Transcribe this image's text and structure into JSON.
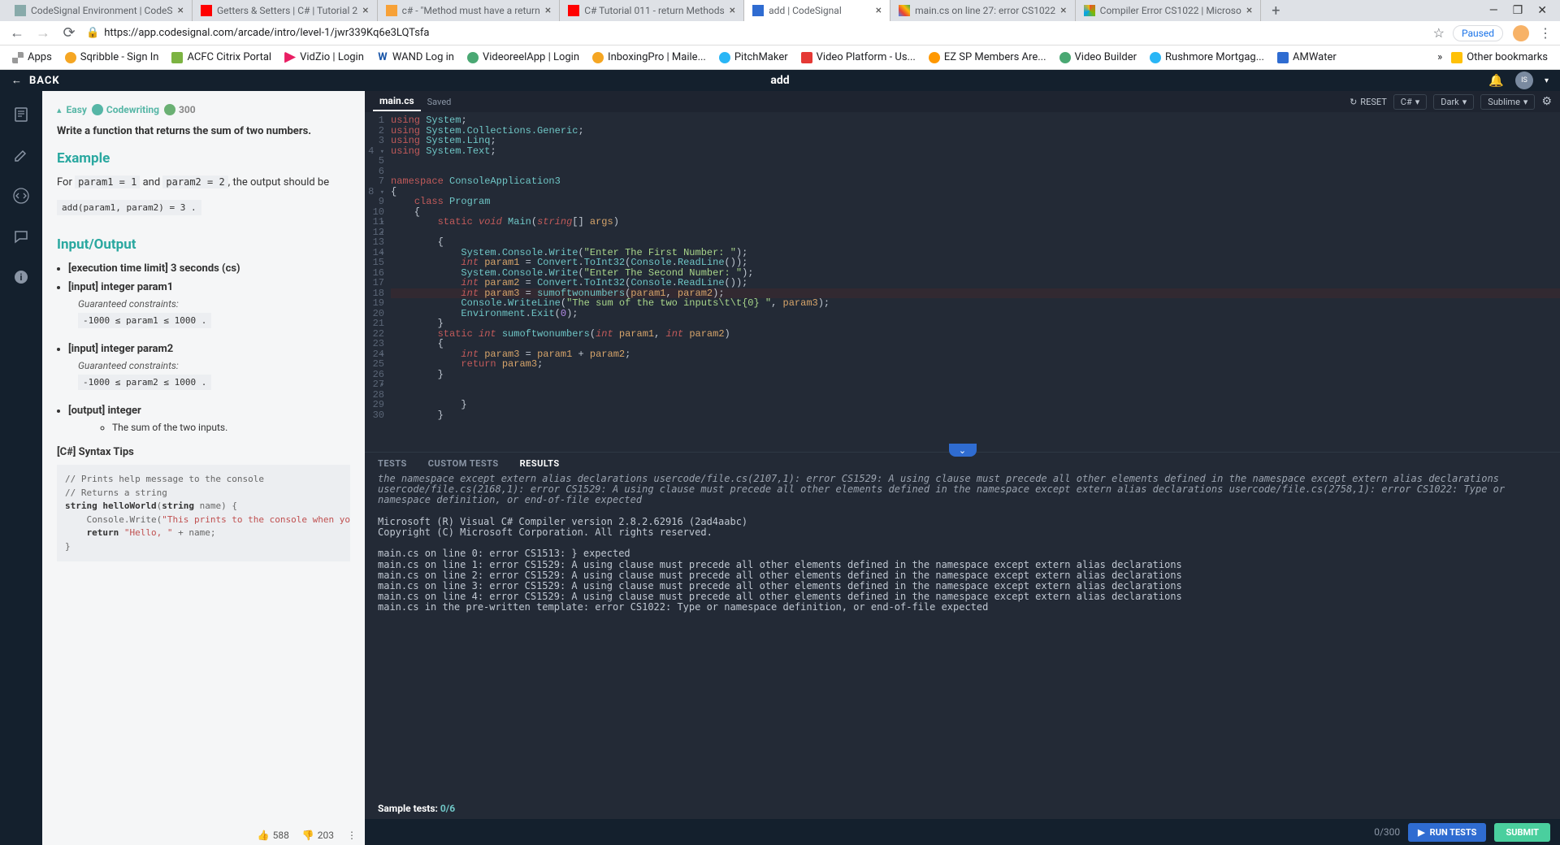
{
  "browser": {
    "tabs": [
      "CodeSignal Environment | CodeS",
      "Getters & Setters | C# | Tutorial 2",
      "c# - \"Method must have a return",
      "C# Tutorial 011 - return Methods",
      "add | CodeSignal",
      "main.cs on line 27: error CS1022",
      "Compiler Error CS1022 | Microso"
    ],
    "url": "https://app.codesignal.com/arcade/intro/level-1/jwr339Kq6e3LQTsfa",
    "paused": "Paused",
    "apps_label": "Apps",
    "other_bookmarks": "Other bookmarks"
  },
  "bookmarks": [
    "Sqribble - Sign In",
    "ACFC Citrix Portal",
    "VidZio | Login",
    "WAND Log in",
    "VideoreelApp | Login",
    "InboxingPro | Maile...",
    "PitchMaker",
    "Video Platform - Us...",
    "EZ SP Members Are...",
    "Video Builder",
    "Rushmore Mortgag...",
    "AMWater"
  ],
  "topbar": {
    "back": "BACK",
    "title": "add",
    "avatar": "IS"
  },
  "panel": {
    "difficulty": "Easy",
    "codewriting": "Codewriting",
    "coins": "300",
    "intro": "Write a function that returns the sum of two numbers.",
    "example_h": "Example",
    "example_for": "For",
    "example_p1": "param1 = 1",
    "example_and": "and",
    "example_p2": "param2 = 2",
    "example_tail": ", the output should be",
    "example_call": "add(param1, param2) = 3",
    "io_h": "Input/Output",
    "io_time": "[execution time limit] 3 seconds (cs)",
    "io_in1": "[input] integer param1",
    "io_gc": "Guaranteed constraints:",
    "io_c1": "-1000 ≤ param1 ≤ 1000",
    "io_in2": "[input] integer param2",
    "io_c2": "-1000 ≤ param2 ≤ 1000",
    "io_out": "[output] integer",
    "io_out_sub": "The sum of the two inputs.",
    "syntax_h": "[C#] Syntax Tips",
    "up": "588",
    "down": "203"
  },
  "editor": {
    "file": "main.cs",
    "saved": "Saved",
    "reset": "RESET",
    "lang": "C#",
    "theme": "Dark",
    "keymap": "Sublime"
  },
  "results": {
    "tabs": {
      "t0": "TESTS",
      "t1": "CUSTOM TESTS",
      "t2": "RESULTS"
    },
    "trail1": "the namespace except extern alias declarations usercode/file.cs(2107,1): error CS1529: A using clause must precede all other elements defined in the namespace except extern alias declarations usercode/file.cs(2168,1): error CS1529: A using clause must precede all other elements defined in the namespace except extern alias declarations usercode/file.cs(2758,1): error CS1022: Type or namespace definition, or end-of-file expected",
    "l1": "Microsoft (R) Visual C# Compiler version 2.8.2.62916 (2ad4aabc)",
    "l2": "Copyright (C) Microsoft Corporation. All rights reserved.",
    "e0": "main.cs on line 0: error CS1513: } expected",
    "e1": "main.cs on line 1: error CS1529: A using clause must precede all other elements defined in the namespace except extern alias declarations",
    "e2": "main.cs on line 2: error CS1529: A using clause must precede all other elements defined in the namespace except extern alias declarations",
    "e3": "main.cs on line 3: error CS1529: A using clause must precede all other elements defined in the namespace except extern alias declarations",
    "e4": "main.cs on line 4: error CS1529: A using clause must precede all other elements defined in the namespace except extern alias declarations",
    "e5": "main.cs in the pre-written template: error CS1022: Type or namespace definition, or end-of-file expected",
    "sample": "Sample tests:",
    "sample_count": "0/6"
  },
  "bottom": {
    "score": "0/300",
    "run": "RUN TESTS",
    "submit": "SUBMIT"
  }
}
